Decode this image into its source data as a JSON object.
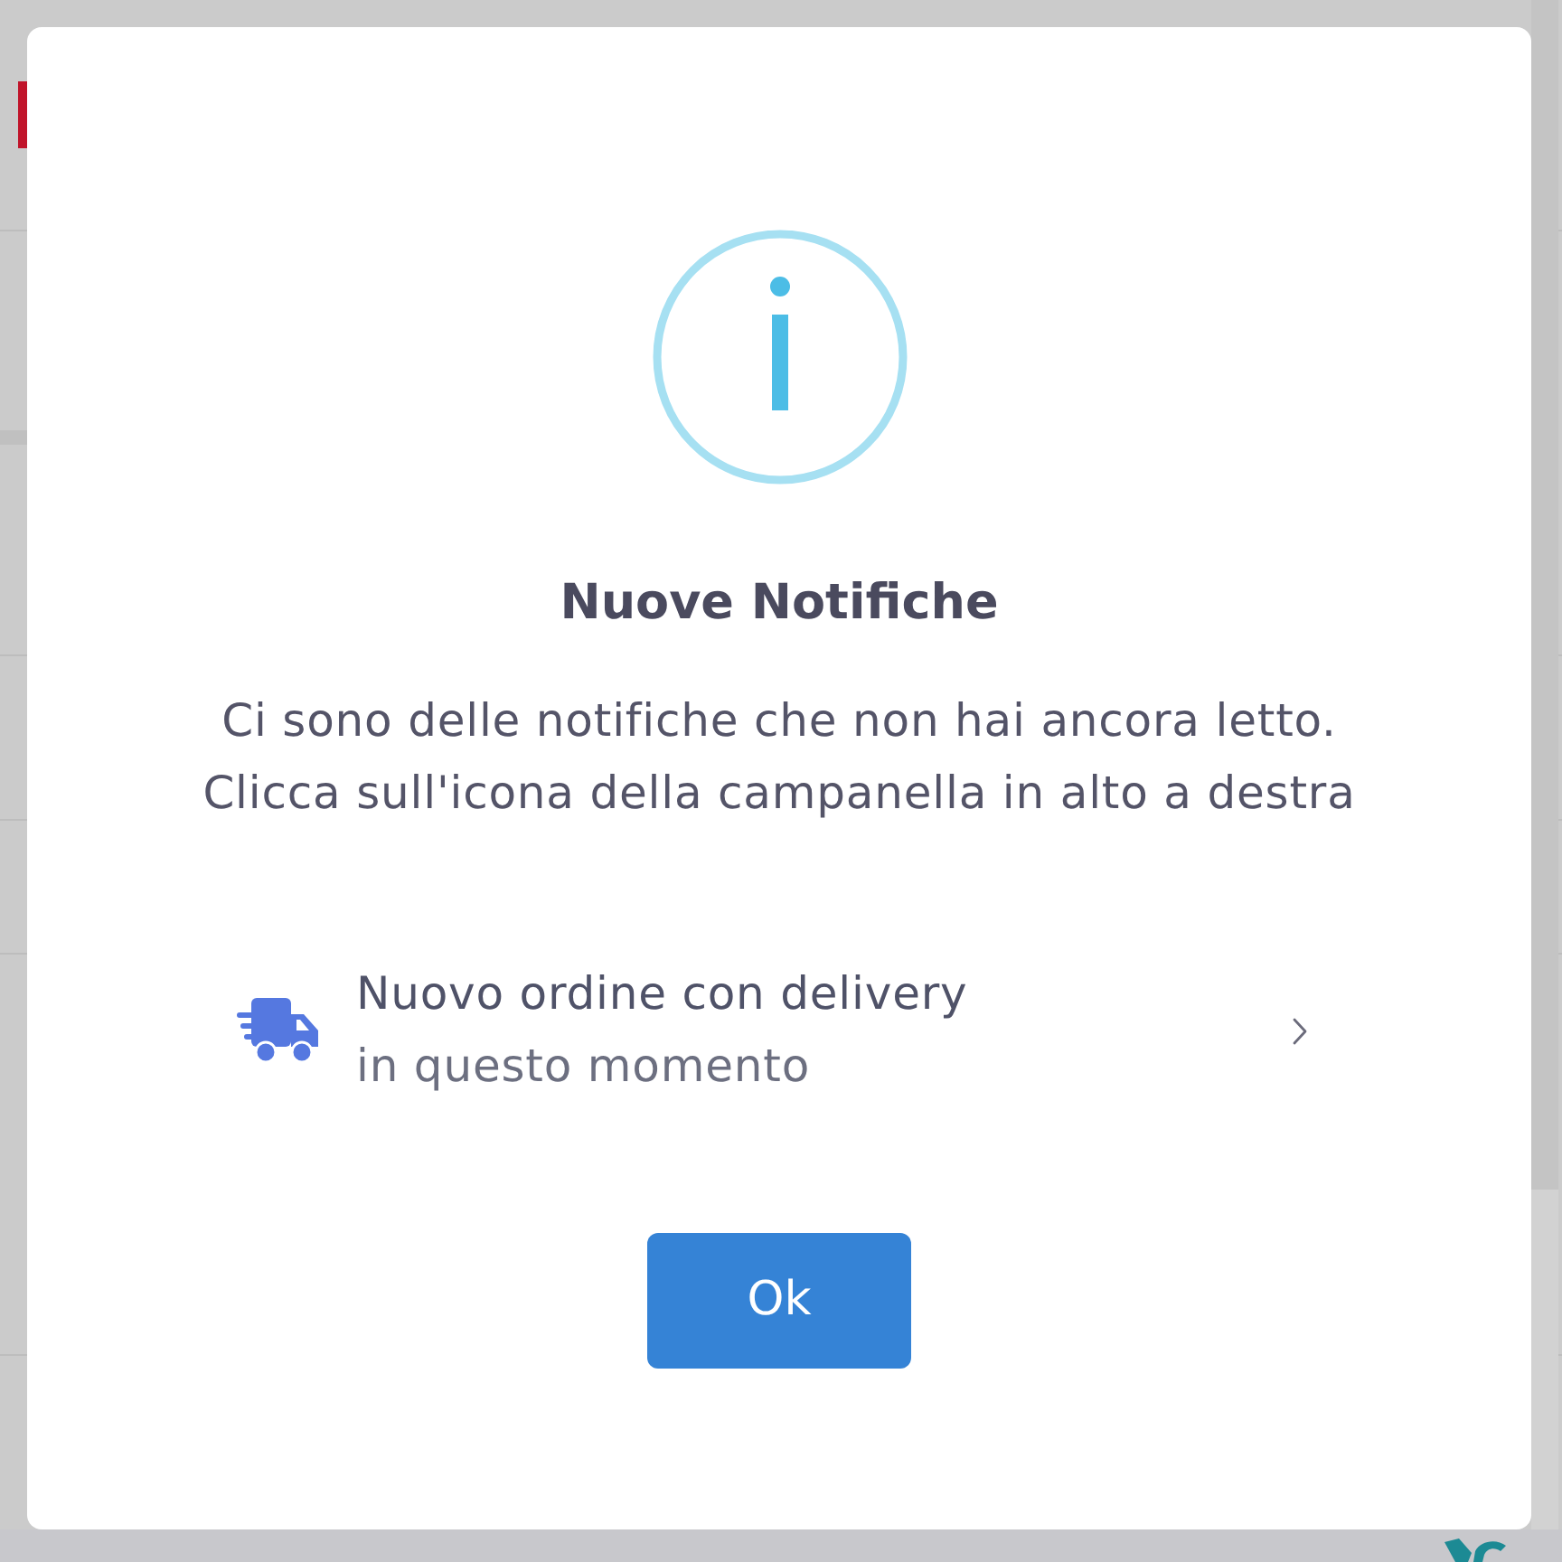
{
  "dialog": {
    "title": "Nuove Notifiche",
    "message": [
      "Ci sono delle notifiche che non hai ancora letto.",
      "Clicca sull'icona della campanella in alto a destra"
    ],
    "notifications": [
      {
        "title": "Nuovo ordine con delivery",
        "time": "in questo momento"
      }
    ],
    "buttons": [
      {
        "label": "Ok"
      }
    ]
  }
}
